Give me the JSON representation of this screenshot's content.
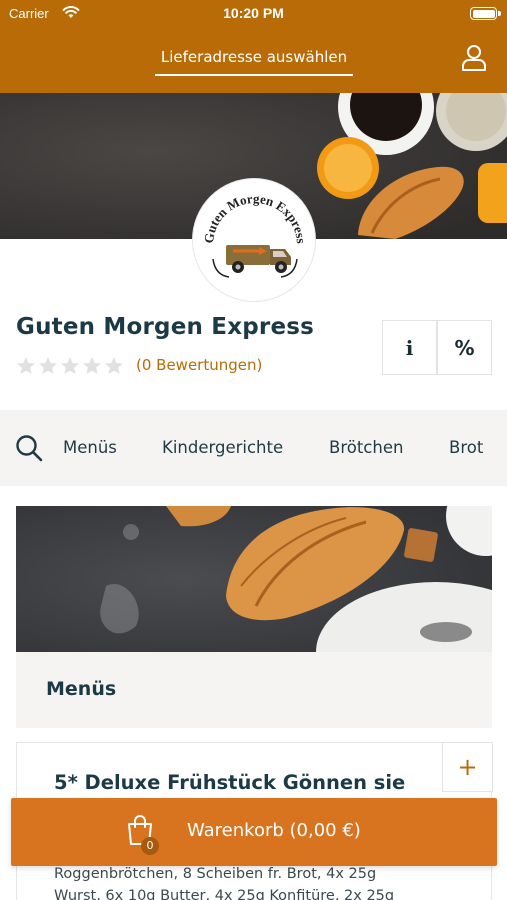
{
  "status_bar": {
    "carrier": "Carrier",
    "time": "10:20 PM"
  },
  "header": {
    "address_label": "Lieferadresse auswählen",
    "user_icon": "user-icon",
    "background_color": "#b86b07"
  },
  "restaurant": {
    "name": "Guten Morgen Express",
    "logo_text": "Guten Morgen Express",
    "rating_stars": 0,
    "reviews_label": "(0 Bewertungen)",
    "info_button": "i",
    "discount_button": "%"
  },
  "categories": {
    "search_icon": "search-icon",
    "items": [
      "Menüs",
      "Kindergerichte",
      "Brötchen",
      "Brot"
    ]
  },
  "section": {
    "title": "Menüs"
  },
  "product": {
    "title": "5* Deluxe Frühstück Gönnen sie",
    "add_label": "+",
    "description_line1": "Roggenbrötchen, 8 Scheiben fr. Brot, 4x 25g",
    "description_line2": "Wurst, 6x 10g Butter, 4x 25g Konfitüre, 2x 25g"
  },
  "cart": {
    "label": "Warenkorb (0,00 €)",
    "count": "0",
    "background_color": "#d8741f"
  }
}
